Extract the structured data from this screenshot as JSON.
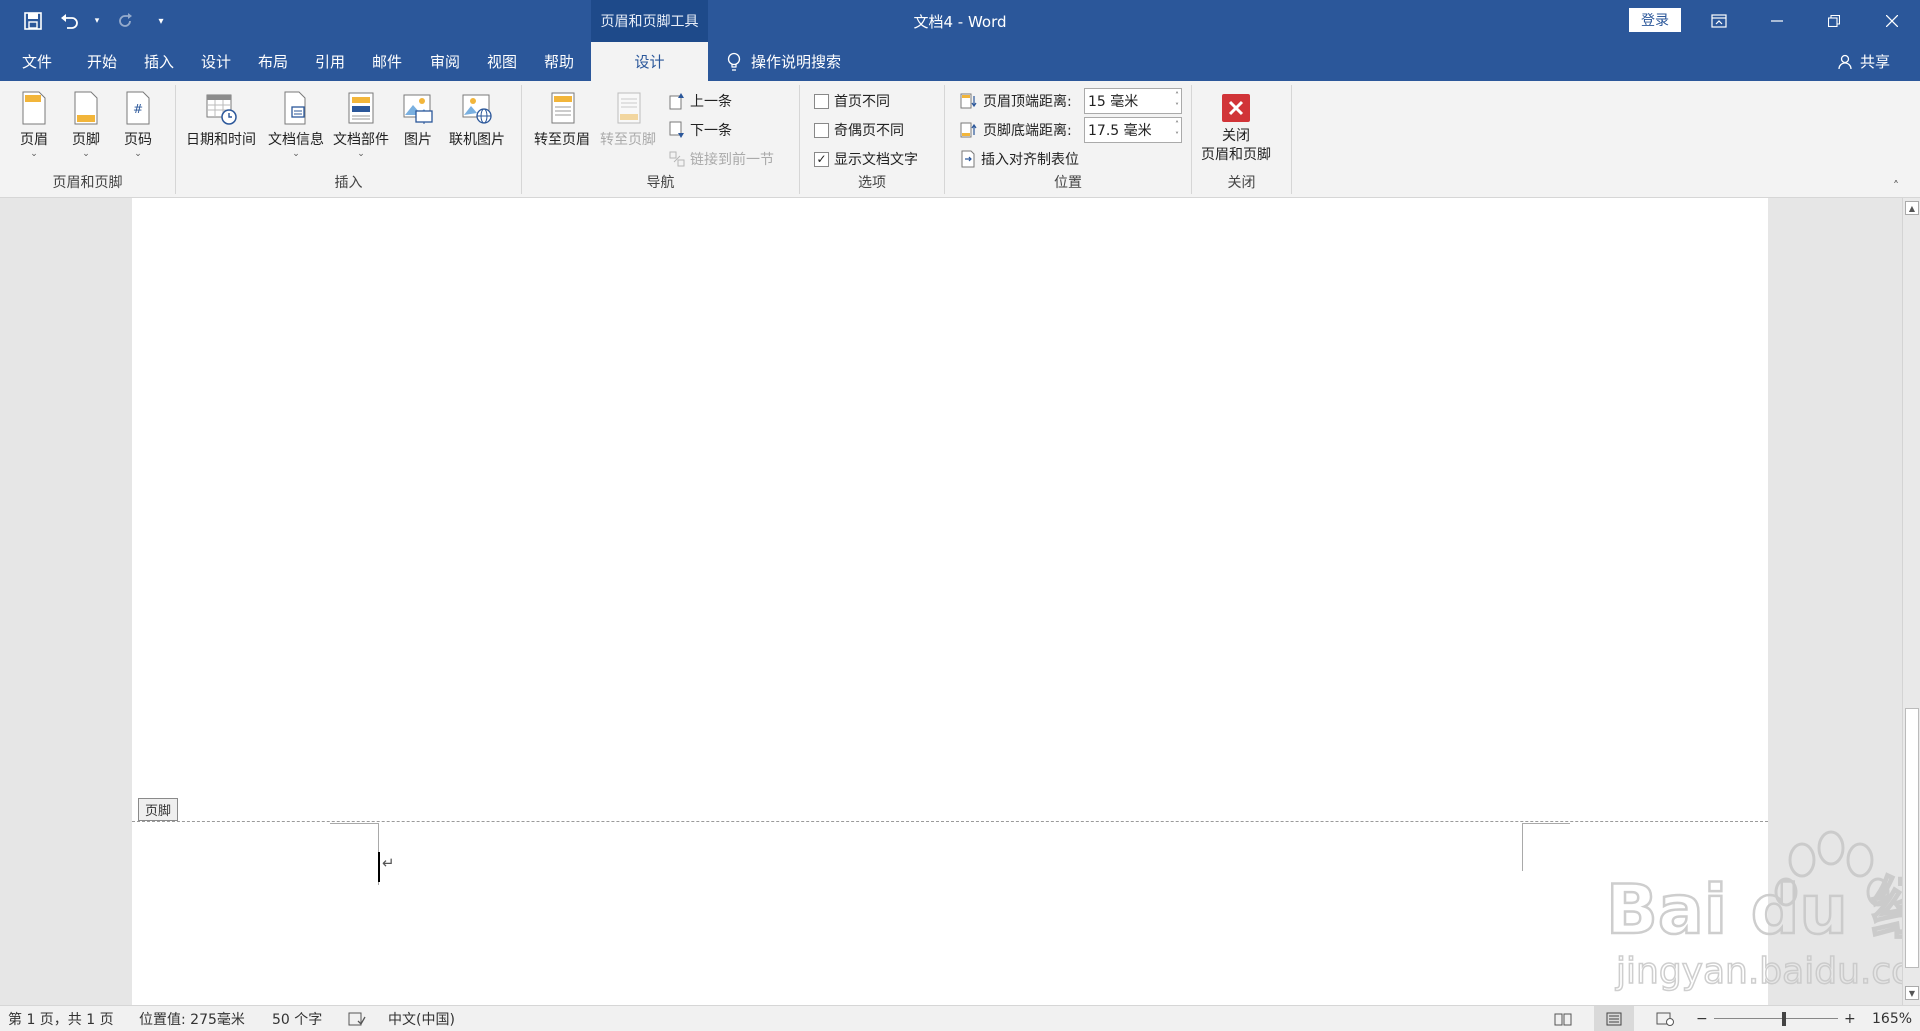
{
  "window": {
    "title": "文档4  -  Word",
    "context_tool": "页眉和页脚工具",
    "login_label": "登录"
  },
  "tabs": [
    {
      "label": "文件"
    },
    {
      "label": "开始"
    },
    {
      "label": "插入"
    },
    {
      "label": "设计"
    },
    {
      "label": "布局"
    },
    {
      "label": "引用"
    },
    {
      "label": "邮件"
    },
    {
      "label": "审阅"
    },
    {
      "label": "视图"
    },
    {
      "label": "帮助"
    },
    {
      "label": "设计"
    }
  ],
  "tell_me": "操作说明搜索",
  "share": "共享",
  "ribbon": {
    "header_footer": {
      "label": "页眉和页脚",
      "header": "页眉",
      "footer": "页脚",
      "page_number": "页码"
    },
    "insert": {
      "label": "插入",
      "datetime": "日期和时间",
      "docinfo": "文档信息",
      "docparts": "文档部件",
      "picture": "图片",
      "online_picture": "联机图片"
    },
    "navigation": {
      "label": "导航",
      "goto_header": "转至页眉",
      "goto_footer": "转至页脚",
      "previous": "上一条",
      "next": "下一条",
      "link_previous": "链接到前一节"
    },
    "options": {
      "label": "选项",
      "different_first": "首页不同",
      "different_odd_even": "奇偶页不同",
      "show_doc_text": "显示文档文字",
      "show_doc_text_checked": true
    },
    "position": {
      "label": "位置",
      "header_top_label": "页眉顶端距离:",
      "header_top_value": "15 毫米",
      "footer_bottom_label": "页脚底端距离:",
      "footer_bottom_value": "17.5 毫米",
      "insert_align_tab": "插入对齐制表位"
    },
    "close": {
      "label": "关闭",
      "button_line1": "关闭",
      "button_line2": "页眉和页脚"
    }
  },
  "document": {
    "footer_tag": "页脚",
    "para_mark": "↵"
  },
  "status": {
    "page": "第 1 页，共 1 页",
    "position": "位置值: 275毫米",
    "word_count": "50 个字",
    "language": "中文(中国)",
    "zoom": "165%"
  },
  "watermark": {
    "brand": "Bai du 经验",
    "url": "jingyan.baidu.com"
  },
  "colors": {
    "accent": "#2b579a",
    "close_red": "#d13438"
  }
}
